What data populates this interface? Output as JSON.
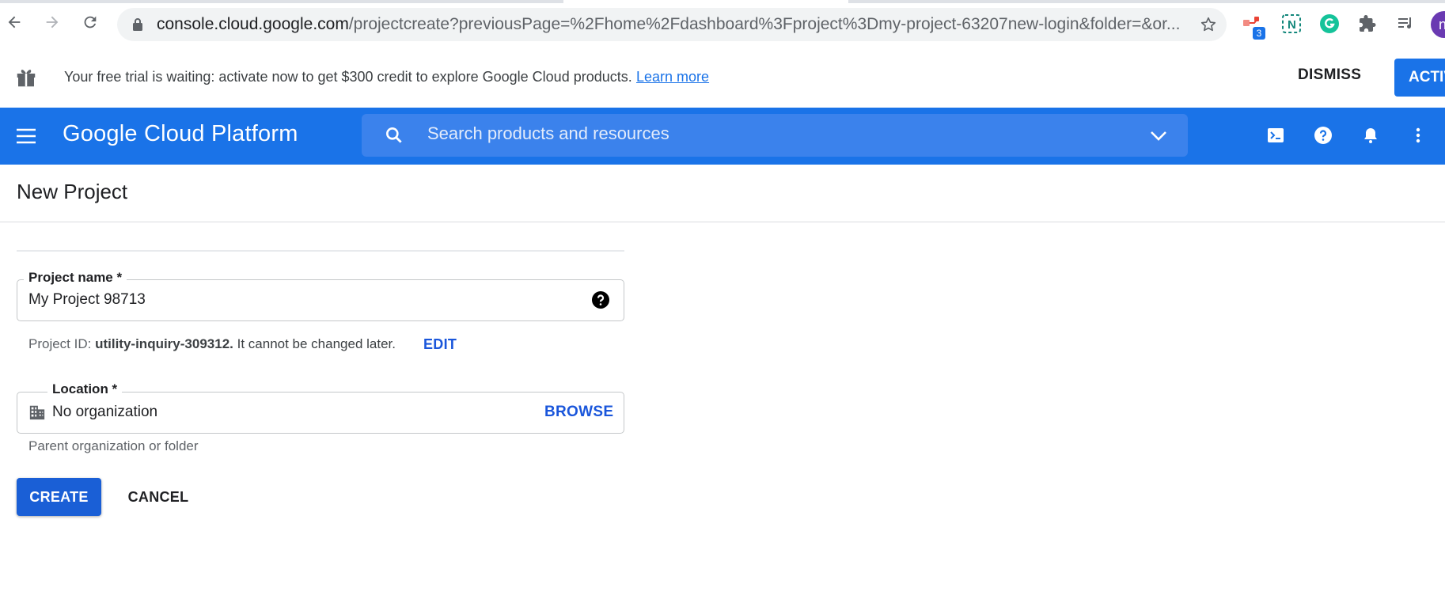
{
  "browser": {
    "url_host": "console.cloud.google.com",
    "url_rest": "/projectcreate?previousPage=%2Fhome%2Fdashboard%3Fproject%3Dmy-project-63207new-login&folder=&or...",
    "extension_badge": "3",
    "profile_initial": "n",
    "icons": [
      "back-arrow-icon",
      "forward-arrow-icon",
      "reload-icon",
      "lock-icon",
      "bookmark-star-icon",
      "extension-flow-icon",
      "extension-n-icon",
      "grammarly-icon",
      "extensions-puzzle-icon",
      "reading-list-icon"
    ]
  },
  "banner": {
    "text": "Your free trial is waiting: activate now to get $300 credit to explore Google Cloud products.",
    "learn_more": "Learn more",
    "dismiss": "DISMISS",
    "activate": "ACTIVATE"
  },
  "header": {
    "title": "Google Cloud Platform",
    "search_placeholder": "Search products and resources",
    "color": "#1a73e8"
  },
  "page": {
    "title": "New Project"
  },
  "form": {
    "project_name_label": "Project name *",
    "project_name_value": "My Project 98713",
    "project_id_prefix": "Project ID:",
    "project_id_value": "utility-inquiry-309312.",
    "project_id_note": "It cannot be changed later.",
    "edit": "EDIT",
    "location_label": "Location *",
    "location_value": "No organization",
    "browse": "BROWSE",
    "location_hint": "Parent organization or folder",
    "create": "CREATE",
    "cancel": "CANCEL"
  }
}
